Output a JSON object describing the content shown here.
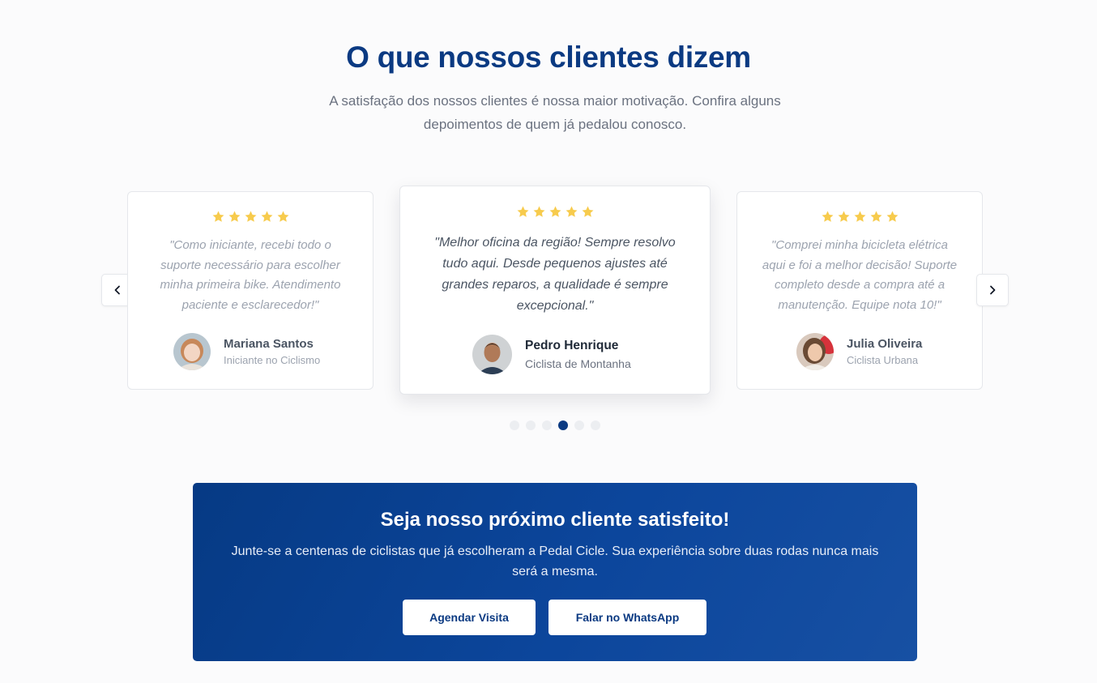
{
  "section": {
    "title": "O que nossos clientes dizem",
    "subtitle": "A satisfação dos nossos clientes é nossa maior motivação. Confira alguns depoimentos de quem já pedalou conosco."
  },
  "testimonials": [
    {
      "rating": 5,
      "quote": "\"Como iniciante, recebi todo o suporte necessário para escolher minha primeira bike. Atendimento paciente e esclarecedor!\"",
      "name": "Mariana Santos",
      "role": "Iniciante no Ciclismo"
    },
    {
      "rating": 5,
      "quote": "\"Melhor oficina da região! Sempre resolvo tudo aqui. Desde pequenos ajustes até grandes reparos, a qualidade é sempre excepcional.\"",
      "name": "Pedro Henrique",
      "role": "Ciclista de Montanha"
    },
    {
      "rating": 5,
      "quote": "\"Comprei minha bicicleta elétrica aqui e foi a melhor decisão! Suporte completo desde a compra até a manutenção. Equipe nota 10!\"",
      "name": "Julia Oliveira",
      "role": "Ciclista Urbana"
    }
  ],
  "carousel": {
    "prev_icon": "chevron-left-icon",
    "next_icon": "chevron-right-icon",
    "dot_count": 6,
    "active_dot": 4
  },
  "cta": {
    "title": "Seja nosso próximo cliente satisfeito!",
    "text": "Junte-se a centenas de ciclistas que já escolheram a Pedal Cicle. Sua experiência sobre duas rodas nunca mais será a mesma.",
    "primary_label": "Agendar Visita",
    "secondary_label": "Falar no WhatsApp"
  },
  "colors": {
    "brand": "#0b3a82",
    "star": "#f7cb4d",
    "cta_gradient_start": "#063a84",
    "cta_gradient_end": "#1750a3"
  }
}
